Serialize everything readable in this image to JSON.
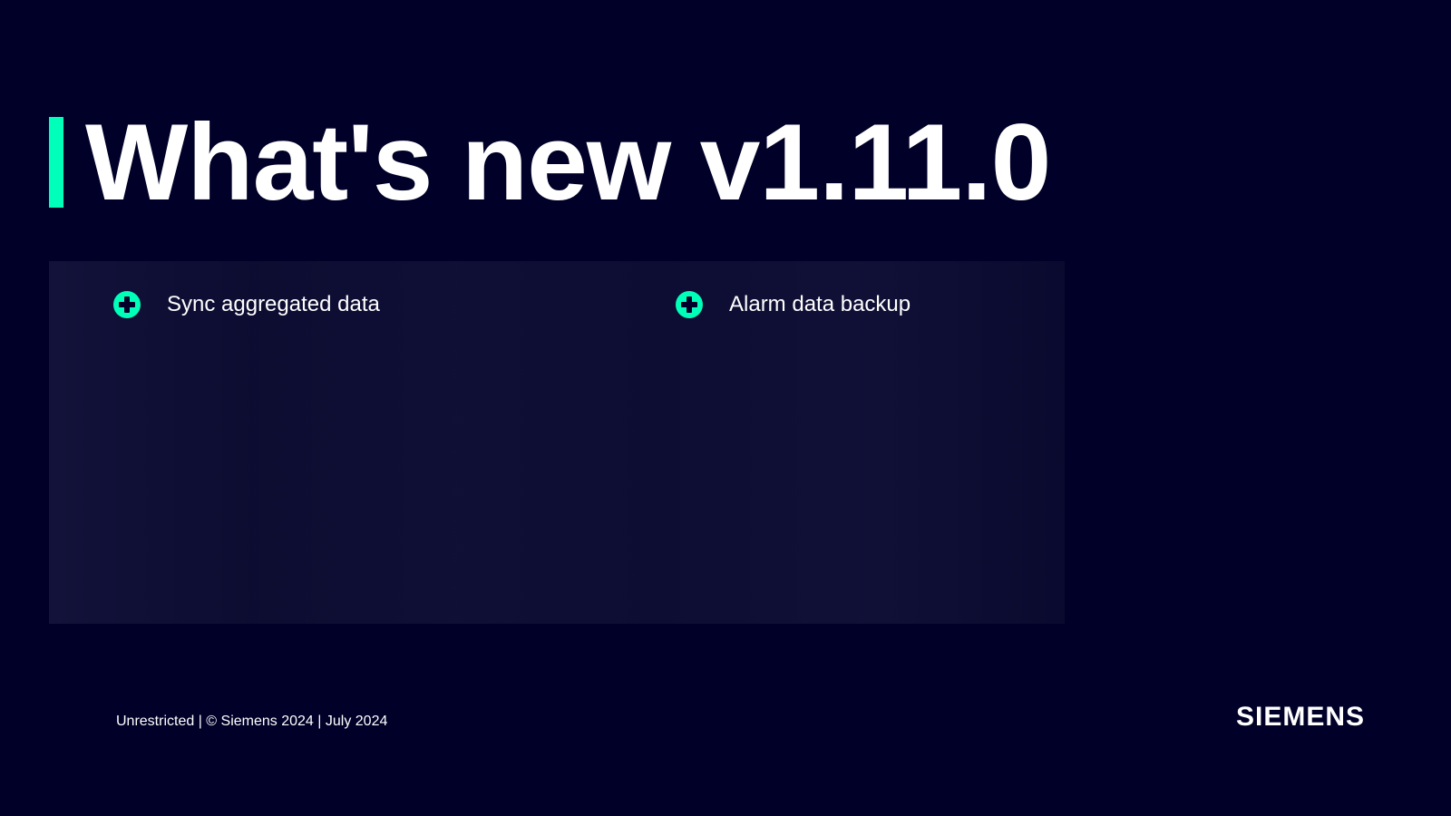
{
  "title": "What's new v1.11.0",
  "features": [
    {
      "label": "Sync aggregated data"
    },
    {
      "label": "Alarm data backup"
    }
  ],
  "footer": "Unrestricted | © Siemens 2024 | July 2024",
  "brand": "SIEMENS",
  "colors": {
    "background": "#000028",
    "accent": "#00ffb9",
    "text": "#ffffff"
  }
}
